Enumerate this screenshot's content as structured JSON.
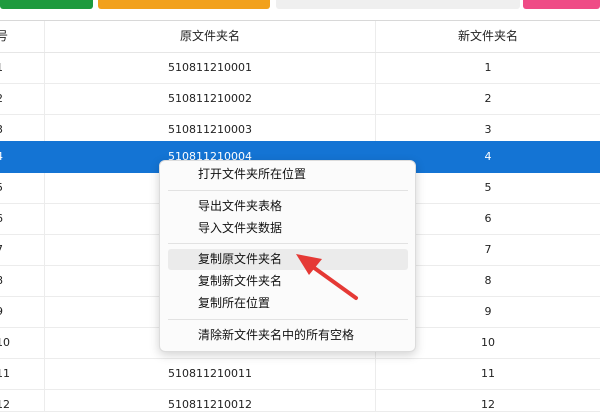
{
  "colors": {
    "selected_row": "#1474d4",
    "arrow": "#e53935"
  },
  "table": {
    "headers": {
      "index": "号",
      "original": "原文件夹名",
      "new": "新文件夹名"
    },
    "rows": [
      {
        "index": "1",
        "original": "510811210001",
        "new": "1"
      },
      {
        "index": "2",
        "original": "510811210002",
        "new": "2"
      },
      {
        "index": "3",
        "original": "510811210003",
        "new": "3"
      },
      {
        "index": "4",
        "original": "510811210004",
        "new": "4"
      },
      {
        "index": "5",
        "original": "",
        "new": "5"
      },
      {
        "index": "6",
        "original": "",
        "new": "6"
      },
      {
        "index": "7",
        "original": "",
        "new": "7"
      },
      {
        "index": "8",
        "original": "",
        "new": "8"
      },
      {
        "index": "9",
        "original": "",
        "new": "9"
      },
      {
        "index": "10",
        "original": "",
        "new": "10"
      },
      {
        "index": "11",
        "original": "510811210011",
        "new": "11"
      },
      {
        "index": "12",
        "original": "510811210012",
        "new": "12"
      }
    ]
  },
  "context_menu": {
    "items": [
      {
        "label": "打开文件夹所在位置"
      },
      {
        "label": "导出文件夹表格"
      },
      {
        "label": "导入文件夹数据"
      },
      {
        "label": "复制原文件夹名"
      },
      {
        "label": "复制新文件夹名"
      },
      {
        "label": "复制所在位置"
      },
      {
        "label": "清除新文件夹名中的所有空格"
      }
    ]
  }
}
